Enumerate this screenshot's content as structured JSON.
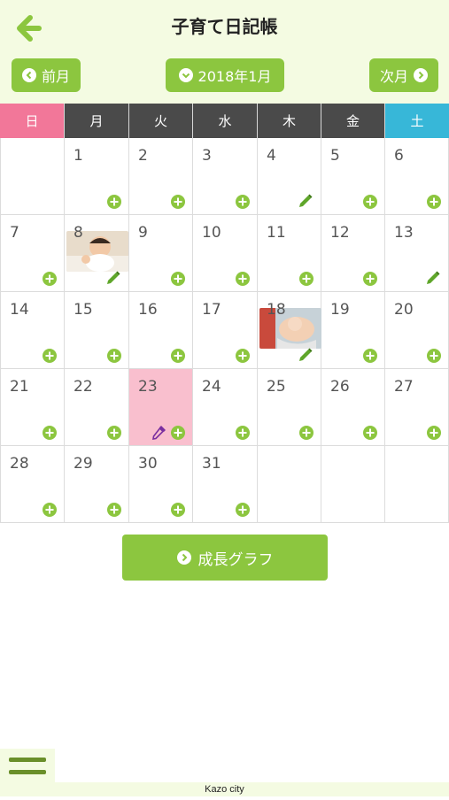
{
  "header": {
    "title": "子育て日記帳",
    "prev_label": "前月",
    "month_label": "2018年1月",
    "next_label": "次月"
  },
  "calendar": {
    "weekdays": [
      "日",
      "月",
      "火",
      "水",
      "木",
      "金",
      "土"
    ],
    "weeks": [
      [
        {
          "d": "",
          "icon": "none"
        },
        {
          "d": "1",
          "icon": "add"
        },
        {
          "d": "2",
          "icon": "add"
        },
        {
          "d": "3",
          "icon": "add"
        },
        {
          "d": "4",
          "icon": "pencil"
        },
        {
          "d": "5",
          "icon": "add"
        },
        {
          "d": "6",
          "icon": "add"
        }
      ],
      [
        {
          "d": "7",
          "icon": "add"
        },
        {
          "d": "8",
          "icon": "pencil",
          "photo": true
        },
        {
          "d": "9",
          "icon": "add"
        },
        {
          "d": "10",
          "icon": "add"
        },
        {
          "d": "11",
          "icon": "add"
        },
        {
          "d": "12",
          "icon": "add"
        },
        {
          "d": "13",
          "icon": "pencil"
        }
      ],
      [
        {
          "d": "14",
          "icon": "add"
        },
        {
          "d": "15",
          "icon": "add"
        },
        {
          "d": "16",
          "icon": "add"
        },
        {
          "d": "17",
          "icon": "add"
        },
        {
          "d": "18",
          "icon": "pencil",
          "photo": true
        },
        {
          "d": "19",
          "icon": "add"
        },
        {
          "d": "20",
          "icon": "add"
        }
      ],
      [
        {
          "d": "21",
          "icon": "add"
        },
        {
          "d": "22",
          "icon": "add"
        },
        {
          "d": "23",
          "icon": "add",
          "today": true,
          "dropper": true
        },
        {
          "d": "24",
          "icon": "add"
        },
        {
          "d": "25",
          "icon": "add"
        },
        {
          "d": "26",
          "icon": "add"
        },
        {
          "d": "27",
          "icon": "add"
        }
      ],
      [
        {
          "d": "28",
          "icon": "add"
        },
        {
          "d": "29",
          "icon": "add"
        },
        {
          "d": "30",
          "icon": "add"
        },
        {
          "d": "31",
          "icon": "add"
        },
        {
          "d": "",
          "icon": "none"
        },
        {
          "d": "",
          "icon": "none"
        },
        {
          "d": "",
          "icon": "none"
        }
      ]
    ]
  },
  "growth_label": "成長グラフ",
  "footer": {
    "text": "Kazo city"
  },
  "colors": {
    "accent": "#8cc63f",
    "sunday": "#f27799",
    "saturday": "#37b7d8",
    "weekday": "#4a4a4a",
    "today": "#f9bfce"
  }
}
